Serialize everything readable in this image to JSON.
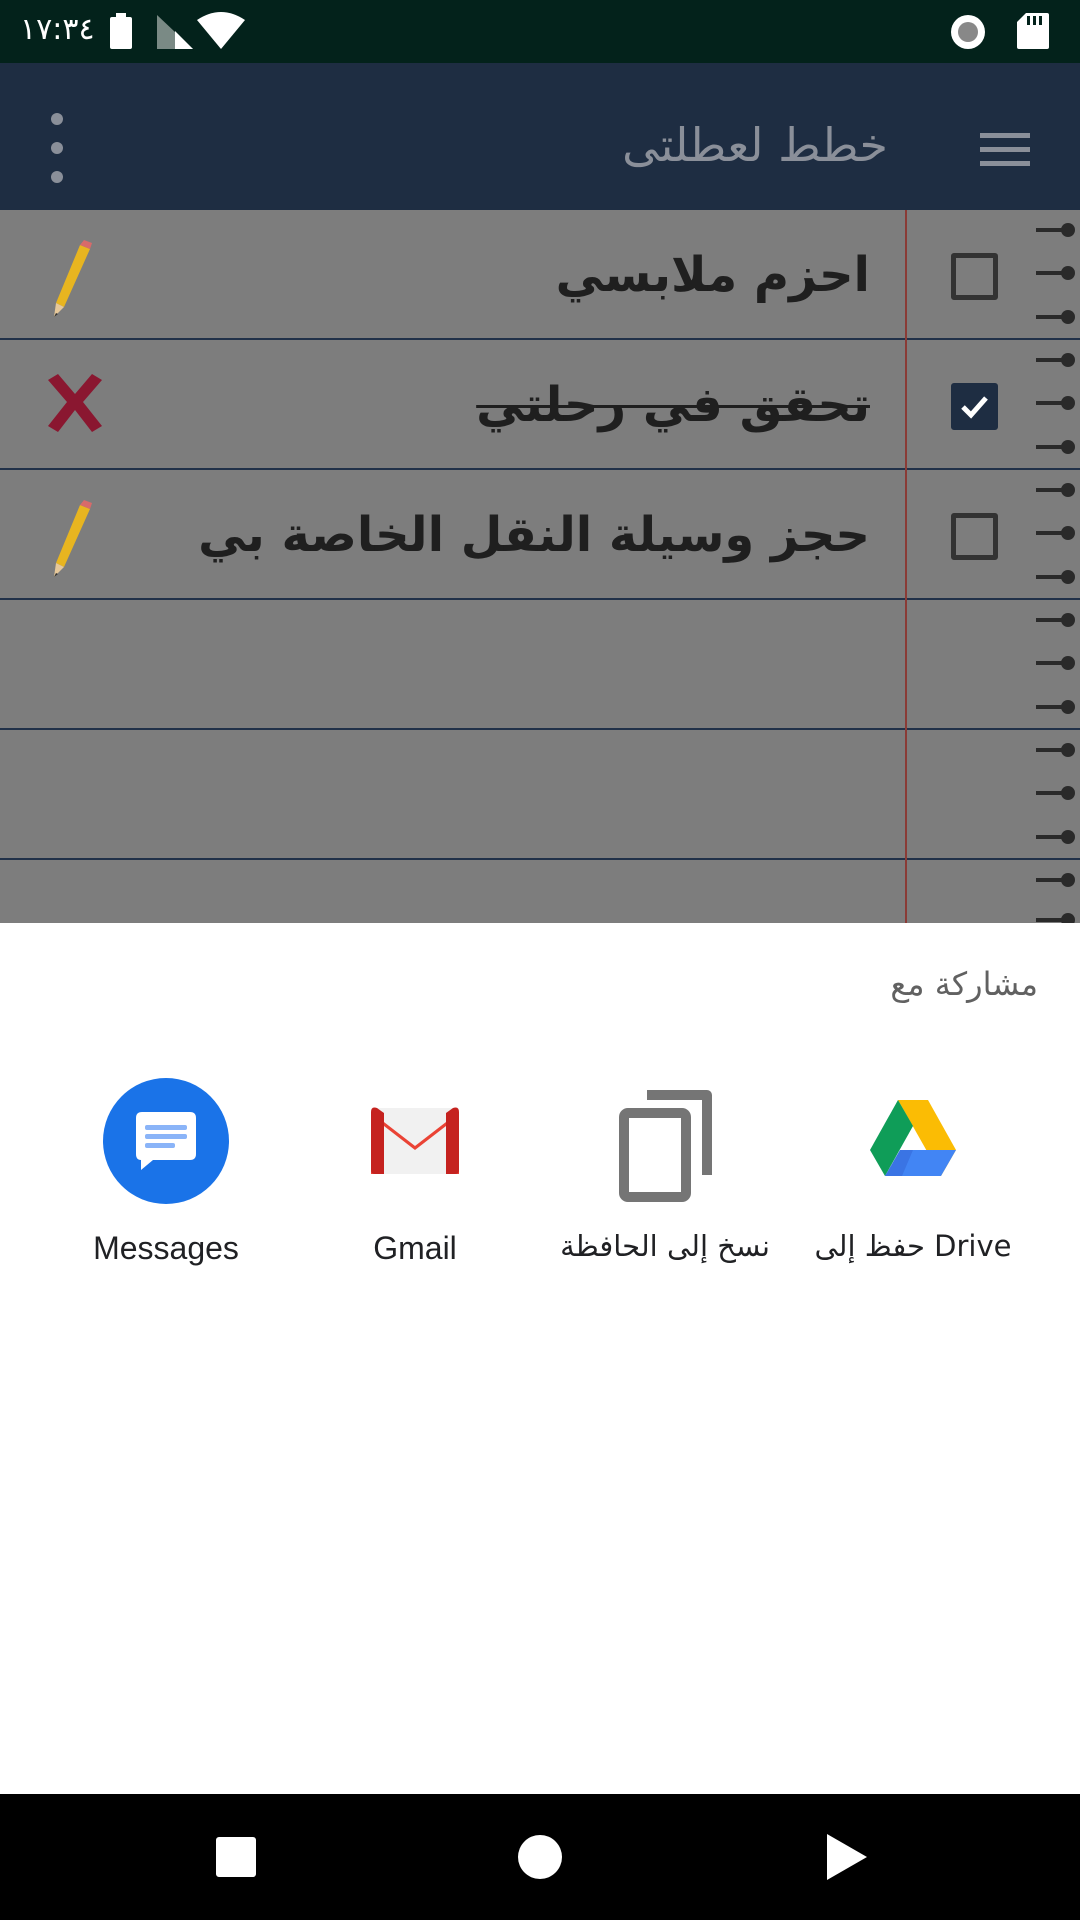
{
  "status_bar": {
    "time": "١٧:٣٤",
    "icons": [
      "battery-icon",
      "signal-icon",
      "wifi-icon",
      "record-icon",
      "sd-card-icon"
    ]
  },
  "app_bar": {
    "title": "خطط لعطلتى",
    "menu_icon": "hamburger-menu-icon",
    "overflow_icon": "more-vertical-icon",
    "color": "#1e2d42"
  },
  "list": {
    "items": [
      {
        "text": "احزم ملابسي",
        "checked": false,
        "action_icon": "pencil-icon"
      },
      {
        "text": "تحقق في رحلتي",
        "checked": true,
        "action_icon": "delete-x-icon"
      },
      {
        "text": "حجز وسيلة النقل الخاصة بي",
        "checked": false,
        "action_icon": "pencil-icon"
      }
    ]
  },
  "share_sheet": {
    "title": "مشاركة مع",
    "targets": [
      {
        "label": "Messages",
        "icon": "messages-icon"
      },
      {
        "label": "Gmail",
        "icon": "gmail-icon"
      },
      {
        "label": "نسخ إلى الحافظة",
        "icon": "copy-clipboard-icon"
      },
      {
        "label": "حفظ إلى Drive",
        "icon": "google-drive-icon"
      }
    ]
  },
  "nav_bar": {
    "buttons": [
      "recents-square-icon",
      "home-circle-icon",
      "back-triangle-icon"
    ]
  }
}
